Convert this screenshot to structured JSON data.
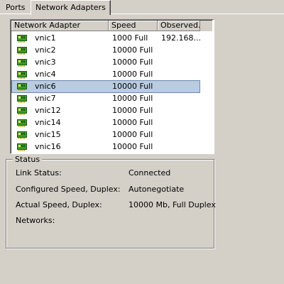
{
  "tabs": [
    {
      "label": "Ports",
      "active": false
    },
    {
      "label": "Network Adapters",
      "active": true
    }
  ],
  "adapter_list": {
    "columns": [
      "Network Adapter",
      "Speed",
      "Observed..."
    ],
    "rows": [
      {
        "name": "vnic1",
        "speed": "1000 Full",
        "observed": "192.168...",
        "selected": false
      },
      {
        "name": "vnic2",
        "speed": "10000 Full",
        "observed": "",
        "selected": false
      },
      {
        "name": "vnic3",
        "speed": "10000 Full",
        "observed": "",
        "selected": false
      },
      {
        "name": "vnic4",
        "speed": "10000 Full",
        "observed": "",
        "selected": false
      },
      {
        "name": "vnic6",
        "speed": "10000 Full",
        "observed": "",
        "selected": true
      },
      {
        "name": "vnic7",
        "speed": "10000 Full",
        "observed": "",
        "selected": false
      },
      {
        "name": "vnic12",
        "speed": "10000 Full",
        "observed": "",
        "selected": false
      },
      {
        "name": "vnic14",
        "speed": "10000 Full",
        "observed": "",
        "selected": false
      },
      {
        "name": "vnic15",
        "speed": "10000 Full",
        "observed": "",
        "selected": false
      },
      {
        "name": "vnic16",
        "speed": "10000 Full",
        "observed": "",
        "selected": false
      }
    ],
    "row_icon": "network-card-icon"
  },
  "status": {
    "title": "Status",
    "link_status_label": "Link Status:",
    "link_status_value": "Connected",
    "configured_speed_label": "Configured Speed, Duplex:",
    "configured_speed_value": "Autonegotiate",
    "actual_speed_label": "Actual Speed, Duplex:",
    "actual_speed_value": "10000 Mb, Full Duplex",
    "networks_label": "Networks:",
    "networks_value": ""
  },
  "colors": {
    "window_bg": "#d4d0c8",
    "selection_bg": "#b9cce0",
    "icon_green": "#3a9a2a"
  }
}
